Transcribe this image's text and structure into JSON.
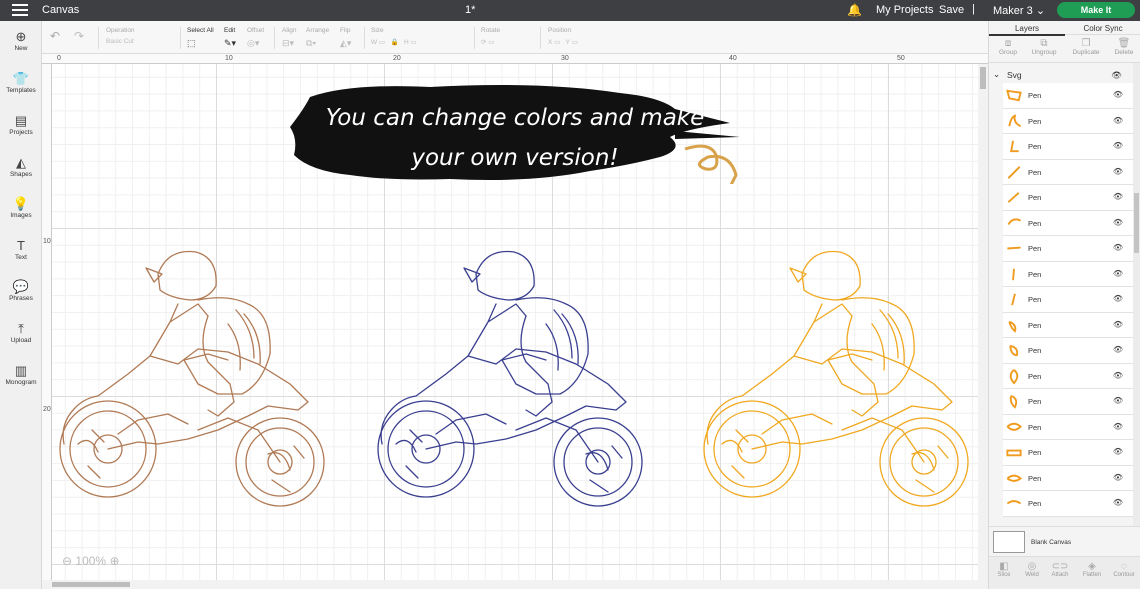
{
  "topbar": {
    "title": "Canvas",
    "doc_name": "1*",
    "my_projects": "My Projects",
    "save": "Save",
    "separator": "|",
    "machine": "Maker 3",
    "make_it": "Make It"
  },
  "leftbar": {
    "items": [
      {
        "label": "New",
        "icon": "plus-icon"
      },
      {
        "label": "Templates",
        "icon": "shirt-icon"
      },
      {
        "label": "Projects",
        "icon": "projects-icon"
      },
      {
        "label": "Shapes",
        "icon": "shapes-icon"
      },
      {
        "label": "Images",
        "icon": "bulb-icon"
      },
      {
        "label": "Text",
        "icon": "text-icon"
      },
      {
        "label": "Phrases",
        "icon": "chat-icon"
      },
      {
        "label": "Upload",
        "icon": "upload-icon"
      },
      {
        "label": "Monogram",
        "icon": "monogram-icon"
      }
    ]
  },
  "toolbar": {
    "operation": "Operation",
    "operation_value": "Basic Cut",
    "select_all": "Select All",
    "edit": "Edit",
    "offset": "Offset",
    "align": "Align",
    "arrange": "Arrange",
    "flip": "Flip",
    "size": "Size",
    "w": "W",
    "h": "H",
    "rotate": "Rotate",
    "position": "Position",
    "x": "X",
    "y": "Y"
  },
  "rulers": {
    "top": [
      "0",
      "10",
      "20",
      "30",
      "40",
      "50"
    ],
    "left": [
      "10",
      "20"
    ]
  },
  "canvas": {
    "banner_line1": "You can change colors and make",
    "banner_line2": "your own version!",
    "zoom": "100%",
    "rider_colors": [
      "#b07a55",
      "#3a3f8f",
      "#f0a820"
    ]
  },
  "rightpanel": {
    "tabs": [
      "Layers",
      "Color Sync"
    ],
    "actions": [
      "Group",
      "Ungroup",
      "Duplicate",
      "Delete"
    ],
    "group_name": "Svg",
    "layers": [
      {
        "name": "Pen",
        "color": "#f09a1e"
      },
      {
        "name": "Pen",
        "color": "#f09a1e"
      },
      {
        "name": "Pen",
        "color": "#f09a1e"
      },
      {
        "name": "Pen",
        "color": "#f09a1e"
      },
      {
        "name": "Pen",
        "color": "#f09a1e"
      },
      {
        "name": "Pen",
        "color": "#f09a1e"
      },
      {
        "name": "Pen",
        "color": "#f09a1e"
      },
      {
        "name": "Pen",
        "color": "#f09a1e"
      },
      {
        "name": "Pen",
        "color": "#f09a1e"
      },
      {
        "name": "Pen",
        "color": "#f09a1e"
      },
      {
        "name": "Pen",
        "color": "#f09a1e"
      },
      {
        "name": "Pen",
        "color": "#f09a1e"
      },
      {
        "name": "Pen",
        "color": "#f09a1e"
      },
      {
        "name": "Pen",
        "color": "#f09a1e"
      },
      {
        "name": "Pen",
        "color": "#f09a1e"
      },
      {
        "name": "Pen",
        "color": "#f09a1e"
      },
      {
        "name": "Pen",
        "color": "#f09a1e"
      }
    ],
    "blank_canvas": "Blank Canvas",
    "bottom_actions": [
      "Slice",
      "Weld",
      "Attach",
      "Flatten",
      "Contour"
    ]
  }
}
